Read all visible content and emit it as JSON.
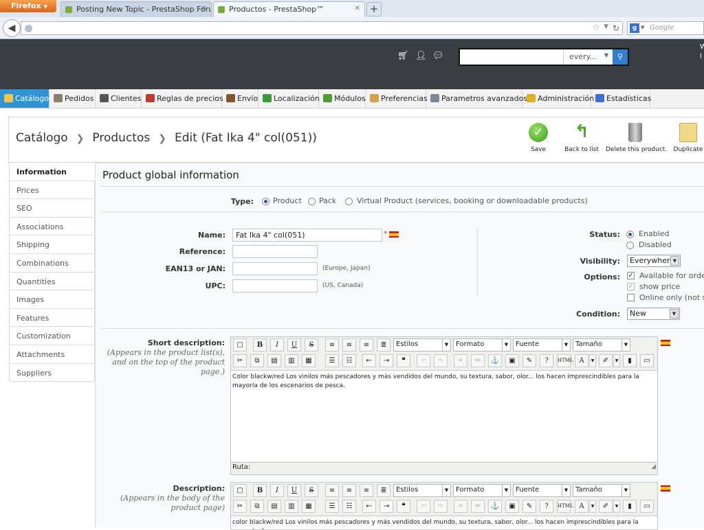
{
  "browser": {
    "menu_button": "Firefox",
    "tabs": [
      {
        "title": "Posting New Topic - PrestaShop Foru...",
        "active": false
      },
      {
        "title": "Productos - PrestaShop™",
        "active": true
      }
    ],
    "new_tab": "+",
    "search_engine_placeholder": "Google"
  },
  "header": {
    "search_option": "every...",
    "right_text_1": "W",
    "right_text_2": "l"
  },
  "menu": [
    {
      "label": "Catálogo",
      "active": true,
      "icon": "folder-icon",
      "color": "#f4c542"
    },
    {
      "label": "Pedidos",
      "active": false,
      "icon": "cart-icon",
      "color": "#8a7f6a"
    },
    {
      "label": "Clientes",
      "active": false,
      "icon": "users-icon",
      "color": "#555555"
    },
    {
      "label": "Reglas de precios",
      "active": false,
      "icon": "price-rules-icon",
      "color": "#c0392b"
    },
    {
      "label": "Envío",
      "active": false,
      "icon": "truck-icon",
      "color": "#7d5a2c"
    },
    {
      "label": "Localización",
      "active": false,
      "icon": "globe-icon",
      "color": "#3a9a3a"
    },
    {
      "label": "Módulos",
      "active": false,
      "icon": "puzzle-icon",
      "color": "#4b9e2f"
    },
    {
      "label": "Preferencias",
      "active": false,
      "icon": "preferences-icon",
      "color": "#d4a24a"
    },
    {
      "label": "Parametros avanzados",
      "active": false,
      "icon": "wrench-icon",
      "color": "#7b8896"
    },
    {
      "label": "Administración",
      "active": false,
      "icon": "key-icon",
      "color": "#e0b020"
    },
    {
      "label": "Estadísticas",
      "active": false,
      "icon": "stats-icon",
      "color": "#3b6fd3"
    }
  ],
  "breadcrumb": [
    "Catálogo",
    "Productos",
    "Edit (Fat Ika 4\" col(051))"
  ],
  "toolbar": {
    "save": "Save",
    "back": "Back to list",
    "delete": "Delete this product.",
    "duplicate": "Duplicate"
  },
  "sidebar": [
    {
      "label": "Information",
      "active": true
    },
    {
      "label": "Prices"
    },
    {
      "label": "SEO"
    },
    {
      "label": "Associations"
    },
    {
      "label": "Shipping"
    },
    {
      "label": "Combinations"
    },
    {
      "label": "Quantities"
    },
    {
      "label": "Images"
    },
    {
      "label": "Features"
    },
    {
      "label": "Customization"
    },
    {
      "label": "Attachments"
    },
    {
      "label": "Suppliers"
    }
  ],
  "form": {
    "title": "Product global information",
    "type_label": "Type:",
    "type_options": [
      "Product",
      "Pack",
      "Virtual Product (services, booking or downloadable products)"
    ],
    "name_label": "Name:",
    "name_value": "Fat Ika 4\" col(051)",
    "required_mark": "*",
    "reference_label": "Reference:",
    "ean_label": "EAN13 or JAN:",
    "ean_hint": "(Europe, Japan)",
    "upc_label": "UPC:",
    "upc_hint": "(US, Canada)",
    "status_label": "Status:",
    "status_enabled": "Enabled",
    "status_disabled": "Disabled",
    "visibility_label": "Visibility:",
    "visibility_value": "Everywhere",
    "options_label": "Options:",
    "opt_available": "Available for order",
    "opt_show_price": "show price",
    "opt_online_only": "Online only (not sol",
    "condition_label": "Condition:",
    "condition_value": "New",
    "short_desc_label": "Short description:",
    "short_desc_hint": "(Appears in the product list(s), and on the top of the product page.)",
    "desc_label": "Description:",
    "desc_hint": "(Appears in the body of the product page)",
    "short_desc_text": "Color blackw/red Los vinilos más pescadores y más vendidos del mundo, su textura, sabor, olor... los hacen imprescindibles para la mayoría de los escenarios de pesca.",
    "desc_text": "color blackw/red Los vinilos más pescadores y más vendidos del mundo, su textura, sabor, olor... los hacen imprescindibles para la mayoría de",
    "path_label": "Ruta:"
  },
  "editor": {
    "styles": "Estilos",
    "format": "Formato",
    "font": "Fuente",
    "size": "Tamaño"
  }
}
